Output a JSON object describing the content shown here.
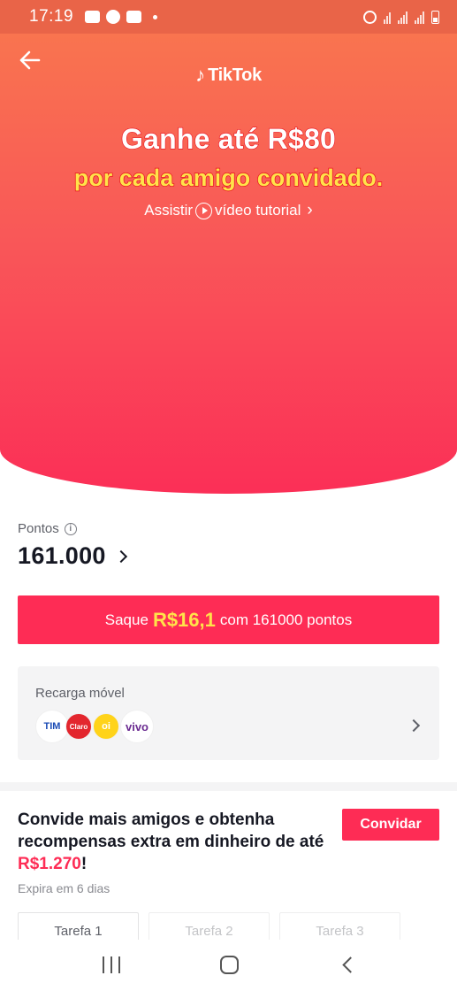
{
  "status_bar": {
    "time": "17:19",
    "icons": [
      "message-icon",
      "whatsapp-icon",
      "youtube-icon",
      "dot-icon",
      "alarm-icon",
      "wifi-call-icon",
      "signal-icon",
      "signal-icon",
      "battery-icon"
    ]
  },
  "header": {
    "back_icon": "arrow-left-icon",
    "logo_text": "TikTok",
    "headline": "Ganhe até R$80",
    "subheadline": "por cada amigo convidado.",
    "tutorial_prefix": "Assistir",
    "tutorial_label": "vídeo tutorial",
    "tutorial_suffix": "›"
  },
  "points": {
    "label": "Pontos",
    "value": "161.000"
  },
  "withdraw": {
    "prefix": "Saque",
    "amount": "R$16,1",
    "suffix": "com 161000 pontos"
  },
  "recharge": {
    "title": "Recarga móvel",
    "carriers": [
      "TIM",
      "Claro",
      "oi",
      "vivo"
    ]
  },
  "invite": {
    "text_before": "Convide mais amigos e obtenha recompensas extra em dinheiro de até ",
    "highlight": "R$1.270",
    "text_after": "!",
    "button_label": "Convidar",
    "expiry": "Expira em 6 dias",
    "tasks": [
      "Tarefa 1",
      "Tarefa 2",
      "Tarefa 3"
    ]
  },
  "colors": {
    "accent": "#fe2c55",
    "highlight_yellow": "#ffe34a",
    "hero_top": "#f9744f",
    "hero_bottom": "#fb2f57"
  }
}
